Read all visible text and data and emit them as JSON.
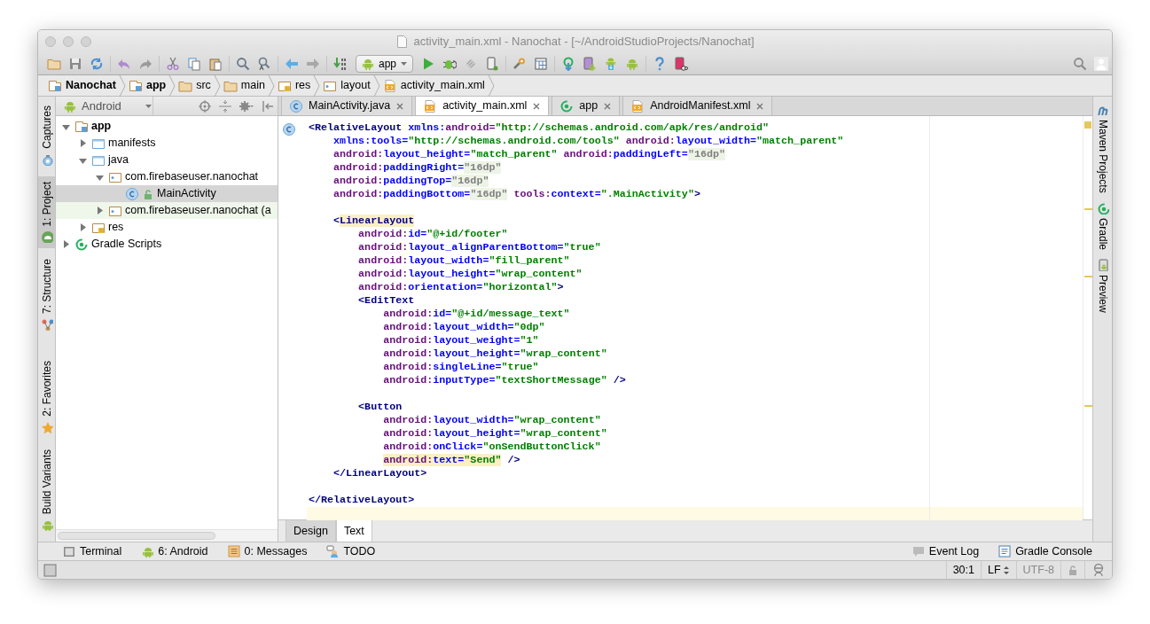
{
  "window": {
    "title": "activity_main.xml - Nanochat - [~/AndroidStudioProjects/Nanochat]"
  },
  "toolbar": {
    "run_configuration": "app"
  },
  "breadcrumbs": [
    {
      "label": "Nanochat",
      "kind": "module"
    },
    {
      "label": "app",
      "kind": "module"
    },
    {
      "label": "src",
      "kind": "folder"
    },
    {
      "label": "main",
      "kind": "folder"
    },
    {
      "label": "res",
      "kind": "resources"
    },
    {
      "label": "layout",
      "kind": "package"
    },
    {
      "label": "activity_main.xml",
      "kind": "xml"
    }
  ],
  "left_stripe": {
    "top": [
      {
        "label": "Captures",
        "kind": "captures",
        "selected": false
      },
      {
        "label": "1: Project",
        "kind": "project",
        "selected": true
      },
      {
        "label": "7: Structure",
        "kind": "structure",
        "selected": false
      }
    ],
    "bottom": [
      {
        "label": "2: Favorites",
        "kind": "favorites",
        "selected": false
      },
      {
        "label": "Build Variants",
        "kind": "variants",
        "selected": false
      }
    ]
  },
  "project_panel": {
    "view": "Android",
    "tree": [
      {
        "label": "app",
        "kind": "module",
        "expanded": true,
        "selected": false,
        "children": [
          {
            "label": "manifests",
            "kind": "folder",
            "expanded": false,
            "selected": false
          },
          {
            "label": "java",
            "kind": "folder",
            "expanded": true,
            "selected": false,
            "children": [
              {
                "label": "com.firebaseuser.nanochat",
                "kind": "package",
                "expanded": true,
                "selected": false,
                "children": [
                  {
                    "label": "MainActivity",
                    "kind": "class",
                    "selected": true
                  }
                ]
              },
              {
                "label": "com.firebaseuser.nanochat (a",
                "kind": "testpackage",
                "expanded": false,
                "selected": false
              }
            ]
          },
          {
            "label": "res",
            "kind": "resources",
            "expanded": false,
            "selected": false
          }
        ]
      },
      {
        "label": "Gradle Scripts",
        "kind": "gradle",
        "expanded": false,
        "selected": false
      }
    ]
  },
  "editor": {
    "tabs": [
      {
        "label": "MainActivity.java",
        "kind": "java",
        "selected": false
      },
      {
        "label": "activity_main.xml",
        "kind": "xml",
        "selected": true
      },
      {
        "label": "app",
        "kind": "module",
        "selected": false
      },
      {
        "label": "AndroidManifest.xml",
        "kind": "xml",
        "selected": false
      }
    ],
    "lines": [
      {
        "kind": "code",
        "segments": [
          {
            "text": "<RelativeLayout",
            "kind": "tag"
          },
          {
            "text": " xmlns:",
            "kind": "attr"
          },
          {
            "text": "android=",
            "kind": "ns"
          },
          {
            "text": "\"http://schemas.android.com/apk/res/android\"",
            "kind": "value"
          }
        ]
      },
      {
        "kind": "code",
        "segments": [
          {
            "text": "    xmlns:",
            "kind": "attr"
          },
          {
            "text": "tools=",
            "kind": "attr"
          },
          {
            "text": "\"http://schemas.android.com/tools\"",
            "kind": "value"
          },
          {
            "text": " android:",
            "kind": "ns"
          },
          {
            "text": "layout_width=",
            "kind": "attr"
          },
          {
            "text": "\"match_parent\"",
            "kind": "value"
          }
        ]
      },
      {
        "kind": "code",
        "segments": [
          {
            "text": "    android:",
            "kind": "ns"
          },
          {
            "text": "layout_height=",
            "kind": "attr"
          },
          {
            "text": "\"match_parent\"",
            "kind": "value"
          },
          {
            "text": " android:",
            "kind": "ns"
          },
          {
            "text": "paddingLeft=",
            "kind": "attr"
          },
          {
            "text": "\"16dp\"",
            "kind": "folded"
          }
        ]
      },
      {
        "kind": "code",
        "segments": [
          {
            "text": "    android:",
            "kind": "ns"
          },
          {
            "text": "paddingRight=",
            "kind": "attr"
          },
          {
            "text": "\"16dp\"",
            "kind": "folded"
          }
        ]
      },
      {
        "kind": "code",
        "segments": [
          {
            "text": "    android:",
            "kind": "ns"
          },
          {
            "text": "paddingTop=",
            "kind": "attr"
          },
          {
            "text": "\"16dp\"",
            "kind": "folded"
          }
        ]
      },
      {
        "kind": "code",
        "segments": [
          {
            "text": "    android:",
            "kind": "ns"
          },
          {
            "text": "paddingBottom=",
            "kind": "attr"
          },
          {
            "text": "\"16dp\"",
            "kind": "folded"
          },
          {
            "text": " tools:",
            "kind": "ns"
          },
          {
            "text": "context=",
            "kind": "attr"
          },
          {
            "text": "\".MainActivity\"",
            "kind": "value"
          },
          {
            "text": ">",
            "kind": "tag"
          }
        ]
      },
      {
        "kind": "blank"
      },
      {
        "kind": "code",
        "segments": [
          {
            "text": "    <",
            "kind": "tag"
          },
          {
            "text": "LinearLayout",
            "kind": "matched"
          }
        ]
      },
      {
        "kind": "code",
        "segments": [
          {
            "text": "        android:",
            "kind": "ns"
          },
          {
            "text": "id=",
            "kind": "attr"
          },
          {
            "text": "\"@+id/footer\"",
            "kind": "value"
          }
        ]
      },
      {
        "kind": "code",
        "segments": [
          {
            "text": "        android:",
            "kind": "ns"
          },
          {
            "text": "layout_alignParentBottom=",
            "kind": "attr"
          },
          {
            "text": "\"true\"",
            "kind": "value"
          }
        ]
      },
      {
        "kind": "code",
        "segments": [
          {
            "text": "        android:",
            "kind": "ns"
          },
          {
            "text": "layout_width=",
            "kind": "attr"
          },
          {
            "text": "\"fill_parent\"",
            "kind": "value"
          }
        ]
      },
      {
        "kind": "code",
        "segments": [
          {
            "text": "        android:",
            "kind": "ns"
          },
          {
            "text": "layout_height=",
            "kind": "attr"
          },
          {
            "text": "\"wrap_content\"",
            "kind": "value"
          }
        ]
      },
      {
        "kind": "code",
        "segments": [
          {
            "text": "        android:",
            "kind": "ns"
          },
          {
            "text": "orientation=",
            "kind": "attr"
          },
          {
            "text": "\"horizontal\"",
            "kind": "value"
          },
          {
            "text": ">",
            "kind": "tag"
          }
        ]
      },
      {
        "kind": "code",
        "segments": [
          {
            "text": "        <EditText",
            "kind": "tag"
          }
        ]
      },
      {
        "kind": "code",
        "segments": [
          {
            "text": "            android:",
            "kind": "ns"
          },
          {
            "text": "id=",
            "kind": "attr"
          },
          {
            "text": "\"@+id/message_text\"",
            "kind": "value"
          }
        ]
      },
      {
        "kind": "code",
        "segments": [
          {
            "text": "            android:",
            "kind": "ns"
          },
          {
            "text": "layout_width=",
            "kind": "attr"
          },
          {
            "text": "\"0dp\"",
            "kind": "value"
          }
        ]
      },
      {
        "kind": "code",
        "segments": [
          {
            "text": "            android:",
            "kind": "ns"
          },
          {
            "text": "layout_weight=",
            "kind": "attr"
          },
          {
            "text": "\"1\"",
            "kind": "value"
          }
        ]
      },
      {
        "kind": "code",
        "segments": [
          {
            "text": "            android:",
            "kind": "ns"
          },
          {
            "text": "layout_height=",
            "kind": "attr"
          },
          {
            "text": "\"wrap_content\"",
            "kind": "value"
          }
        ]
      },
      {
        "kind": "code",
        "segments": [
          {
            "text": "            android:",
            "kind": "ns"
          },
          {
            "text": "singleLine=",
            "kind": "attr"
          },
          {
            "text": "\"true\"",
            "kind": "value"
          }
        ]
      },
      {
        "kind": "code",
        "segments": [
          {
            "text": "            android:",
            "kind": "ns"
          },
          {
            "text": "inputType=",
            "kind": "attr"
          },
          {
            "text": "\"textShortMessage\"",
            "kind": "value"
          },
          {
            "text": " />",
            "kind": "tag"
          }
        ]
      },
      {
        "kind": "blank"
      },
      {
        "kind": "code",
        "segments": [
          {
            "text": "        <Button",
            "kind": "tag"
          }
        ]
      },
      {
        "kind": "code",
        "segments": [
          {
            "text": "            android:",
            "kind": "ns"
          },
          {
            "text": "layout_width=",
            "kind": "attr"
          },
          {
            "text": "\"wrap_content\"",
            "kind": "value"
          }
        ]
      },
      {
        "kind": "code",
        "segments": [
          {
            "text": "            android:",
            "kind": "ns"
          },
          {
            "text": "layout_height=",
            "kind": "attr"
          },
          {
            "text": "\"wrap_content\"",
            "kind": "value"
          }
        ]
      },
      {
        "kind": "code",
        "segments": [
          {
            "text": "            android:",
            "kind": "ns"
          },
          {
            "text": "onClick=",
            "kind": "attr"
          },
          {
            "text": "\"onSendButtonClick\"",
            "kind": "value"
          }
        ]
      },
      {
        "kind": "code",
        "segments": [
          {
            "text": "            android:",
            "kind": "nsmark"
          },
          {
            "text": "text=",
            "kind": "attrmark"
          },
          {
            "text": "\"Send\"",
            "kind": "valuemark"
          },
          {
            "text": " />",
            "kind": "tag"
          }
        ]
      },
      {
        "kind": "code",
        "segments": [
          {
            "text": "    </LinearLayout>",
            "kind": "tag"
          }
        ]
      },
      {
        "kind": "blank"
      },
      {
        "kind": "code",
        "segments": [
          {
            "text": "</RelativeLayout>",
            "kind": "tag"
          }
        ]
      },
      {
        "kind": "caret"
      }
    ],
    "view_tabs": [
      {
        "label": "Design",
        "selected": false
      },
      {
        "label": "Text",
        "selected": true
      }
    ]
  },
  "right_stripe": [
    {
      "label": "Maven Projects",
      "kind": "maven"
    },
    {
      "label": "Gradle",
      "kind": "gradle"
    },
    {
      "label": "Preview",
      "kind": "preview"
    }
  ],
  "tool_windows": {
    "left": [
      {
        "label": "Terminal",
        "kind": "terminal"
      },
      {
        "label": "6: Android",
        "kind": "android"
      },
      {
        "label": "0: Messages",
        "kind": "messages"
      },
      {
        "label": "TODO",
        "kind": "todo"
      }
    ],
    "right": [
      {
        "label": "Event Log",
        "kind": "log"
      },
      {
        "label": "Gradle Console",
        "kind": "console"
      }
    ]
  },
  "status_bar": {
    "position": "30:1",
    "line_separator": "LF",
    "encoding": "UTF-8"
  }
}
